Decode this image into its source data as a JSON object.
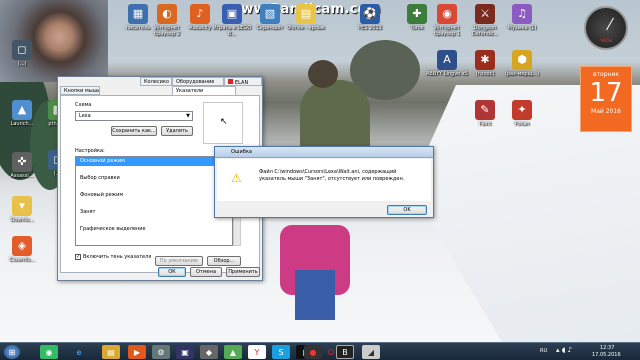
{
  "watermark": "www.Bandicam.com",
  "desktop_icons": [
    {
      "label": "писатель",
      "col": "#3e6fae",
      "glyph": "▦"
    },
    {
      "label": "Интернет браузер 2",
      "col": "#d8691f",
      "glyph": "◐"
    },
    {
      "label": "Audacity",
      "col": "#e06020",
      "glyph": "♪"
    },
    {
      "label": "Играть в LEGO B...",
      "col": "#3a5fb0",
      "glyph": "▣"
    },
    {
      "label": "Скриншот",
      "col": "#3f7fbf",
      "glyph": "▧"
    },
    {
      "label": "Фотки - ярлык",
      "col": "#e8c547",
      "glyph": "▤"
    },
    {
      "label": "PES 2013",
      "col": "#2a5da8",
      "glyph": "⚽"
    },
    {
      "label": "Turok",
      "col": "#3c7d3c",
      "glyph": "✚"
    },
    {
      "label": "Интернет браузер 1",
      "col": "#d94834",
      "glyph": "◉"
    },
    {
      "label": "Dungeon Defende...",
      "col": "#7b2a1e",
      "glyph": "⚔"
    },
    {
      "label": "Музыка (1)",
      "col": "#8b5bc2",
      "glyph": "♫"
    },
    {
      "label": "ABBYY Lingvo x5",
      "col": "#2f4f8a",
      "glyph": "A"
    },
    {
      "label": "(голос)",
      "col": "#9b2d1f",
      "glyph": "✱"
    },
    {
      "label": "(раз-мерщ...)",
      "col": "#d7a621",
      "glyph": "⬢"
    },
    {
      "label": "Paint",
      "col": "#b03535",
      "glyph": "✎"
    },
    {
      "label": "Pokan",
      "col": "#c23b2a",
      "glyph": "✦"
    },
    {
      "label": "Launch...",
      "col": "#4f8fd0",
      "glyph": "▲"
    },
    {
      "label": "pthab...",
      "col": "#4d8b48",
      "glyph": "▩"
    },
    {
      "label": "Assassi...",
      "col": "#606060",
      "glyph": "✜"
    },
    {
      "label": "Downlo...",
      "col": "#e7c14a",
      "glyph": "▾"
    },
    {
      "label": "Clownfis...",
      "col": "#e35d2b",
      "glyph": "◈"
    },
    {
      "label": "(...)",
      "col": "#445566",
      "glyph": "◻"
    },
    {
      "label": "(...)",
      "col": "#3d5f88",
      "glyph": "◻"
    }
  ],
  "mouse_dialog": {
    "tabs": [
      "Колесико",
      "Оборудование",
      "ELAN",
      "Указатели",
      "Кнопки мыши"
    ],
    "scheme_label": "Схема",
    "scheme_value": "Lexa",
    "save_as": "Сохранить как...",
    "delete": "Удалить",
    "customize_label": "Настройка:",
    "items": [
      "Основной режим",
      "Выбор справки",
      "Фоновый режим",
      "Занят",
      "Графическое выделение"
    ],
    "shadow_label": "Включить тень указателя",
    "default_btn": "По умолчанию",
    "browse_btn": "Обзор...",
    "ok": "ОК",
    "cancel": "Отмена",
    "apply": "Применить"
  },
  "error_dialog": {
    "title": "Ошибка",
    "message": "Файл C:\\windows\\Cursors\\Lexa\\Wait.ani, содержащий указатель мыши \"Занят\", отсутствует или поврежден.",
    "ok": "OK"
  },
  "calendar": {
    "weekday": "вторник",
    "day": "17",
    "month_year": "Май 2016"
  },
  "clock": {
    "label": "ЧАСЫ"
  },
  "tray": {
    "lang": "RU",
    "time": "12:37",
    "date": "17.05.2016"
  }
}
